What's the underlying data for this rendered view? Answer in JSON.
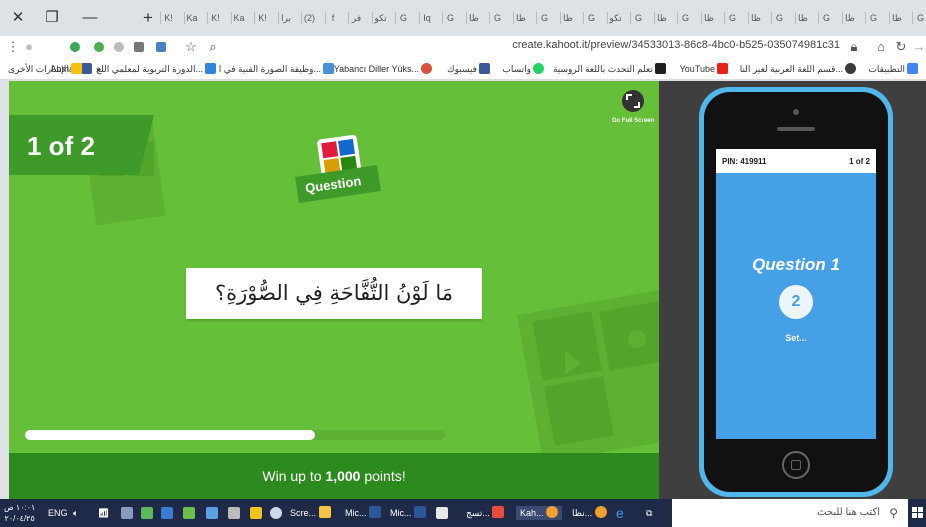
{
  "browser": {
    "url": "create.kahoot.it/preview/34533013-86c8-4bc0-b525-035074981c31",
    "tabs": [
      "K!",
      "Ka",
      "K!",
      "Ka",
      "K!",
      "برا",
      "(2)",
      "f",
      "فر",
      "تكو",
      "G",
      "Iq",
      "G",
      "ظا",
      "G",
      "ظا",
      "G",
      "ظا",
      "G",
      "تكو",
      "G",
      "ظا",
      "G",
      "ظا",
      "G",
      "ظا",
      "G",
      "ظا",
      "G",
      "ظا",
      "G",
      "ظا",
      "G"
    ]
  },
  "bookmarks": [
    {
      "label": "التطبيقات",
      "color": "#4285f4"
    },
    {
      "label": "قسم اللغة العربية لغير النا...",
      "color": "#3c3c3c"
    },
    {
      "label": "YouTube",
      "color": "#e62117"
    },
    {
      "label": "تعلم التحدث باللغة الروسية",
      "color": "#1f1f1f"
    },
    {
      "label": "واتساب",
      "color": "#25d366"
    },
    {
      "label": "فيسبوك",
      "color": "#3b5998"
    },
    {
      "label": "Yabancı Diller Yüks...",
      "color": "#d9533f"
    },
    {
      "label": "وظيفة الصورة الفنية في ا...",
      "color": "#4a90d9"
    },
    {
      "label": "الدورة التربوية لمعلمي اللغ...",
      "color": "#2e86de"
    },
    {
      "label": "Ahmad",
      "color": "#3b5998"
    },
    {
      "label": "»",
      "color": ""
    },
    {
      "label": "الإشارات الأخرى",
      "color": "#f4c20d"
    }
  ],
  "kahoot": {
    "counter": "1 of 2",
    "question_badge": "Question",
    "go_full_screen": "Go Full Screen",
    "question_text": "مَا لَوْنُ التُّفَّاحَةِ فِي الصُّوْرَةِ؟",
    "footer_prefix": "Win up to ",
    "footer_points": "1,000",
    "footer_suffix": " points!",
    "progress": 0.69,
    "colors": {
      "green": "#66bf39",
      "dark_green": "#3e9b2a",
      "footer": "#2d8a1e"
    }
  },
  "phone": {
    "pin": "PIN: 419911",
    "counter": "1 of 2",
    "title": "Question 1",
    "number": "2",
    "status": "Set...",
    "screen_color": "#46a0e5"
  },
  "taskbar": {
    "clock_time": "١٠:٠١ ص",
    "clock_date": "٢٠/٠٤/٢٥",
    "lang": "ENG",
    "search_placeholder": "اكتب هنا للبحث",
    "items": [
      "Scre...",
      "Mic...",
      "Mic...",
      "تسج...",
      "Kah...",
      "نظا..."
    ]
  }
}
